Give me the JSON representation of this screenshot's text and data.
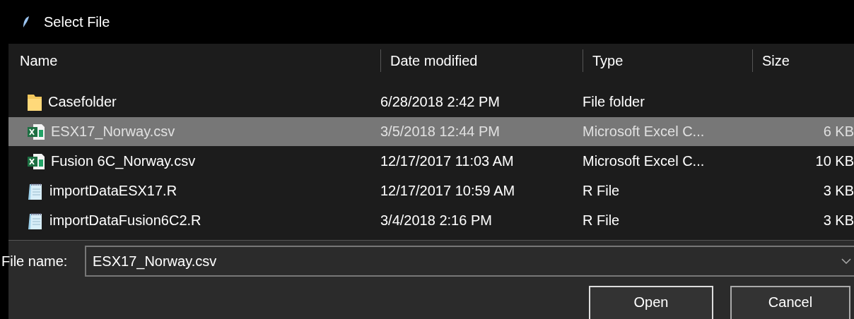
{
  "window": {
    "title": "Select File"
  },
  "table": {
    "columns": [
      "Name",
      "Date modified",
      "Type",
      "Size"
    ],
    "rows": [
      {
        "kind": "folder",
        "name": "Casefolder",
        "date": "6/28/2018 2:42 PM",
        "type": "File folder",
        "size": "",
        "selected": false
      },
      {
        "kind": "excel",
        "name": "ESX17_Norway.csv",
        "date": "3/5/2018 12:44 PM",
        "type": "Microsoft Excel C...",
        "size": "6 KB",
        "selected": true
      },
      {
        "kind": "excel",
        "name": "Fusion 6C_Norway.csv",
        "date": "12/17/2017 11:03 AM",
        "type": "Microsoft Excel C...",
        "size": "10 KB",
        "selected": false
      },
      {
        "kind": "text",
        "name": "importDataESX17.R",
        "date": "12/17/2017 10:59 AM",
        "type": "R File",
        "size": "3 KB",
        "selected": false
      },
      {
        "kind": "text",
        "name": "importDataFusion6C2.R",
        "date": "3/4/2018 2:16 PM",
        "type": "R File",
        "size": "3 KB",
        "selected": false
      }
    ]
  },
  "file_name": {
    "label": "File name:",
    "value": "ESX17_Norway.csv"
  },
  "buttons": [
    "Open",
    "Cancel"
  ]
}
